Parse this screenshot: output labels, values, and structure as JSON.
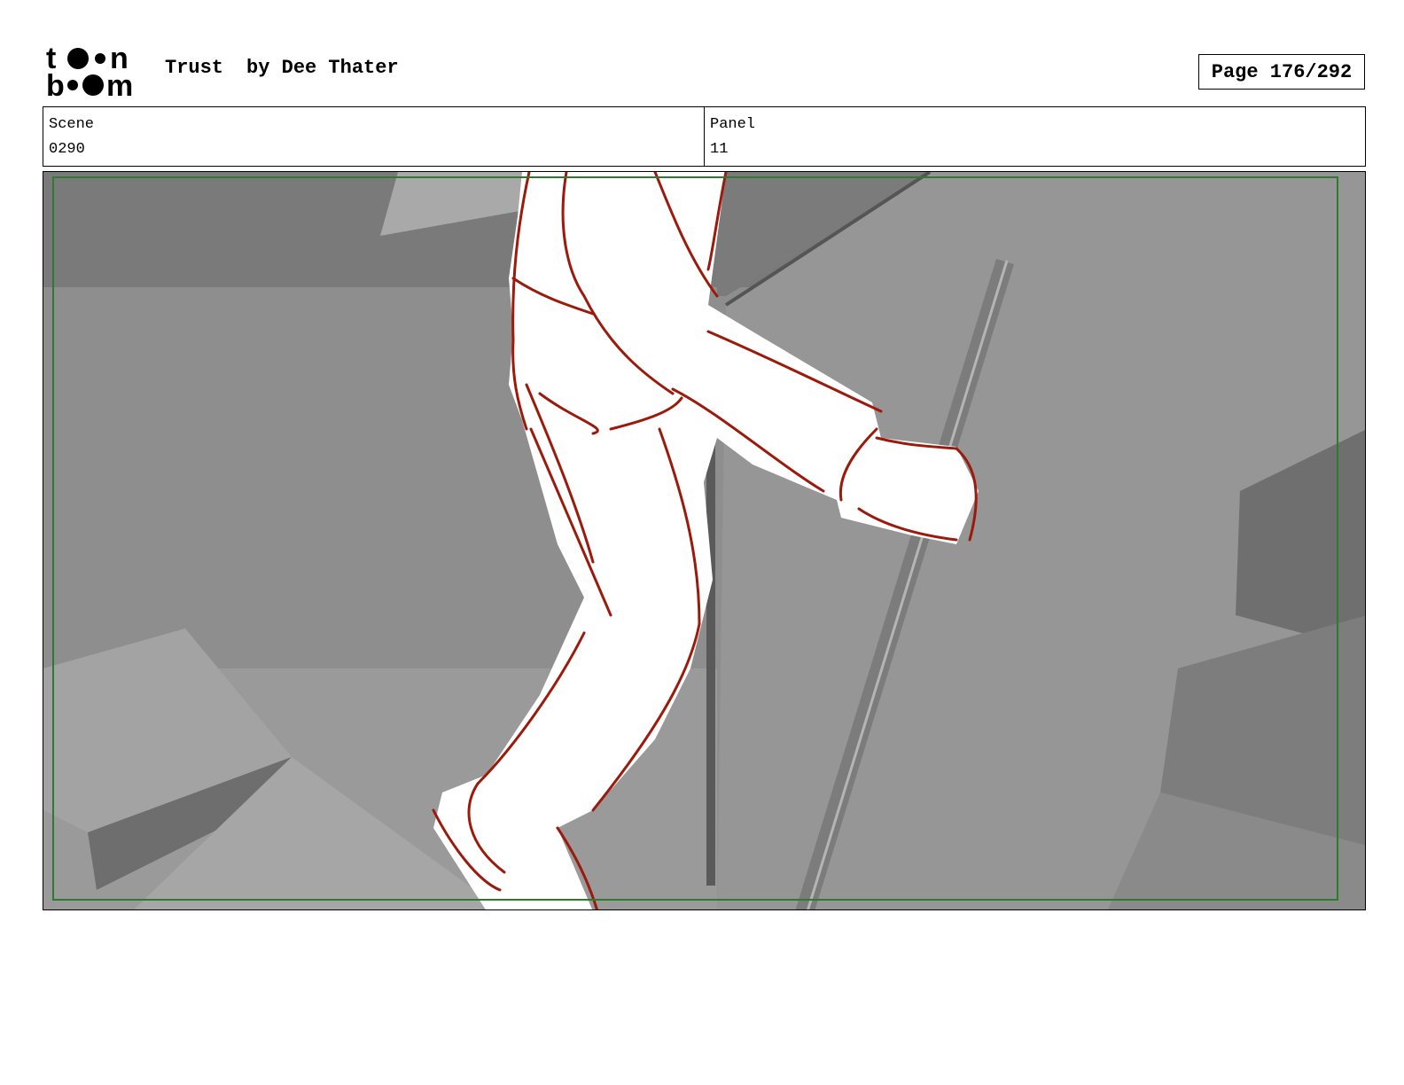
{
  "header": {
    "logo_text": "toon boom",
    "project_title": "Trust",
    "author": "by Dee Thater",
    "page_label": "Page 176/292"
  },
  "info": {
    "scene_label": "Scene",
    "scene_value": "0290",
    "panel_label": "Panel",
    "panel_value": "11"
  },
  "colors": {
    "sketch_line": "#9b1a0c",
    "safe_frame": "#2f7a2f",
    "background_gray": "#8f8f8f"
  }
}
